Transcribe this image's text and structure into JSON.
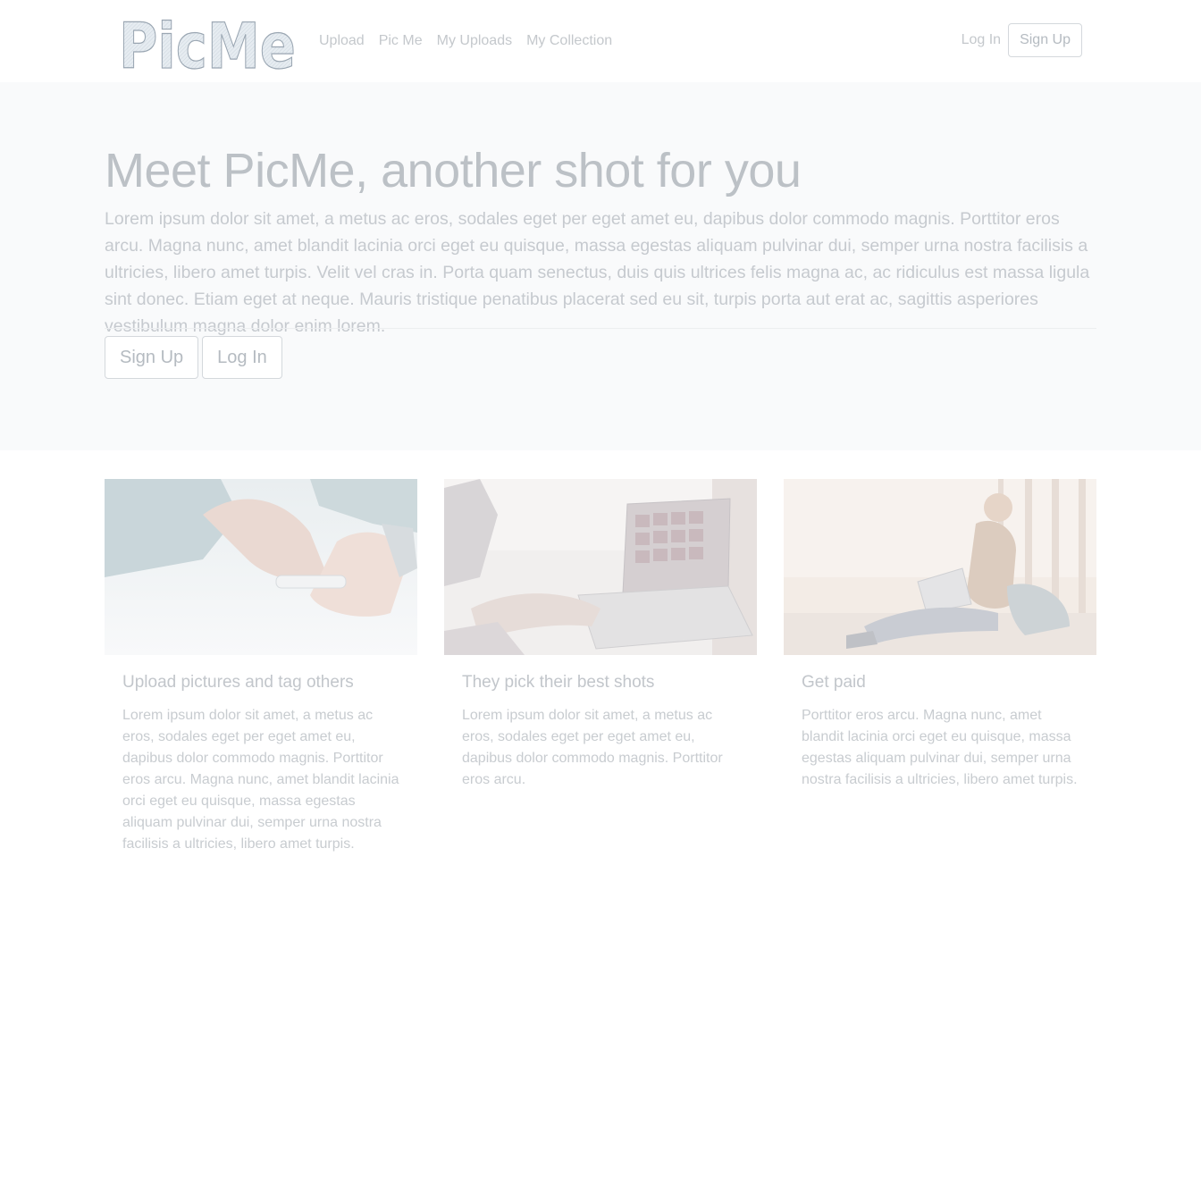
{
  "brand": {
    "logo_text": "PicMe"
  },
  "nav": {
    "links": [
      "Upload",
      "Pic Me",
      "My Uploads",
      "My Collection"
    ],
    "login_label": "Log In",
    "signup_label": "Sign Up"
  },
  "hero": {
    "title": "Meet PicMe, another shot for you",
    "text": "Lorem ipsum dolor sit amet, a metus ac eros, sodales eget per eget amet eu, dapibus dolor commodo magnis. Porttitor eros arcu. Magna nunc, amet blandit lacinia orci eget eu quisque, massa egestas aliquam pulvinar dui, semper urna nostra facilisis a ultricies, libero amet turpis. Velit vel cras in. Porta quam senectus, duis quis ultrices felis magna ac, ac ridiculus est massa ligula sint donec. Etiam eget at neque. Mauris tristique penatibus placerat sed eu sit, turpis porta aut erat ac, sagittis asperiores vestibulum magna dolor enim lorem.",
    "signup_label": "Sign Up",
    "login_label": "Log In"
  },
  "cards": [
    {
      "title": "Upload pictures and tag others",
      "text": "Lorem ipsum dolor sit amet, a metus ac eros, sodales eget per eget amet eu, dapibus dolor commodo magnis. Porttitor eros arcu. Magna nunc, amet blandit lacinia orci eget eu quisque, massa egestas aliquam pulvinar dui, semper urna nostra facilisis a ultricies, libero amet turpis."
    },
    {
      "title": "They pick their best shots",
      "text": "Lorem ipsum dolor sit amet, a metus ac eros, sodales eget per eget amet eu, dapibus dolor commodo magnis. Porttitor eros arcu."
    },
    {
      "title": "Get paid",
      "text": "Porttitor eros arcu. Magna nunc, amet blandit lacinia orci eget eu quisque, massa egestas aliquam pulvinar dui, semper urna nostra facilisis a ultricies, libero amet turpis."
    }
  ]
}
